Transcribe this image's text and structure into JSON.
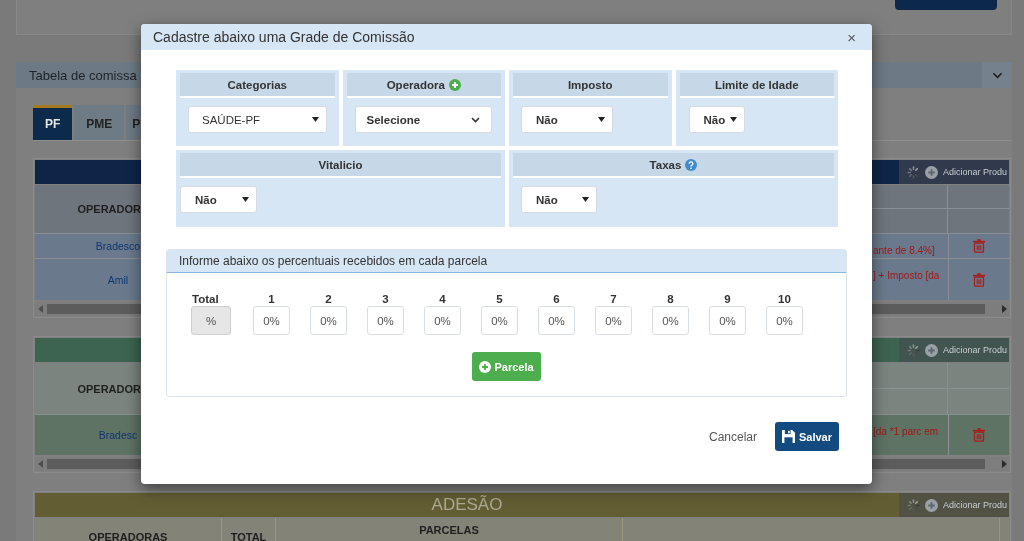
{
  "page": {
    "section_title": "Tabela de comissa",
    "tabs": [
      {
        "label": "PF",
        "selected": true
      },
      {
        "label": "PME",
        "selected": false
      },
      {
        "label": "P",
        "selected": false
      }
    ],
    "tables": [
      {
        "kind": "list",
        "color": "#0f2548",
        "add_button": "Adicionar Produ",
        "header": "OPERADOR",
        "rows": [
          {
            "operator": "Bradesco",
            "detail": "ante de 8.4%]",
            "color": "#6a7a8c"
          },
          {
            "operator": "Amil",
            "detail": "] + Imposto [da",
            "color": "#6a7a8c"
          }
        ]
      },
      {
        "kind": "list",
        "color": "#3d6450",
        "add_button": "Adicionar Produ",
        "header": "OPERADOR",
        "rows": [
          {
            "operator": "Bradesc",
            "detail": "[da *1 parc em",
            "color": "#5e7364"
          }
        ]
      },
      {
        "kind": "grid",
        "color": "#635d33",
        "title": "ADESÃO",
        "add_button": "Adicionar Produ",
        "columns": [
          {
            "label": "OPERADORAS",
            "kind": "single"
          },
          {
            "label": "TOTAL",
            "kind": "single"
          },
          {
            "label": "PARCELAS",
            "kind": "group"
          }
        ]
      }
    ]
  },
  "modal": {
    "title": "Cadastre abaixo uma Grade de Comissão",
    "close": "×",
    "field_rows": [
      {
        "fields": [
          {
            "label": "Categorias",
            "select": {
              "kind": "plain",
              "value": "SAÚDE-PF"
            }
          },
          {
            "label": "Operadora",
            "label_button": {
              "kind": "add"
            },
            "select": {
              "kind": "custom",
              "value": "Selecione"
            }
          },
          {
            "label": "Imposto",
            "select": {
              "kind": "bold",
              "value": "Não"
            }
          },
          {
            "label": "Limite de Idade",
            "select": {
              "kind": "bold",
              "value": "Não"
            }
          }
        ]
      },
      {
        "fields": [
          {
            "label": "Vitalicio",
            "select": {
              "kind": "bold",
              "value": "Não"
            }
          },
          {
            "label": "Taxas",
            "label_button": {
              "kind": "help"
            },
            "select": {
              "kind": "bold",
              "value": "Não"
            }
          }
        ]
      }
    ],
    "installments_panel": {
      "title": "Informe abaixo os percentuais recebidos em cada parcela",
      "total": {
        "label": "Total",
        "value": "%",
        "readonly": true
      },
      "installments": [
        {
          "label": "1",
          "value": "0%"
        },
        {
          "label": "2",
          "value": "0%"
        },
        {
          "label": "3",
          "value": "0%"
        },
        {
          "label": "4",
          "value": "0%"
        },
        {
          "label": "5",
          "value": "0%"
        },
        {
          "label": "6",
          "value": "0%"
        },
        {
          "label": "7",
          "value": "0%"
        },
        {
          "label": "8",
          "value": "0%"
        },
        {
          "label": "9",
          "value": "0%"
        },
        {
          "label": "10",
          "value": "0%"
        }
      ],
      "add_button": "Parcela"
    },
    "cancel_button": "Cancelar",
    "save_button": "Salvar"
  }
}
